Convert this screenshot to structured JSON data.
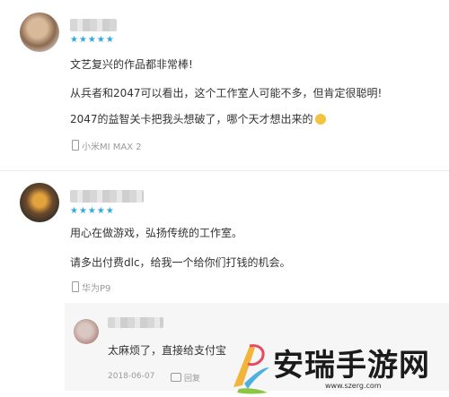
{
  "comments": [
    {
      "stars": "★★★★★",
      "lines": [
        "文艺复兴的作品都非常棒!",
        "从兵者和2047可以看出，这个工作室人可能不多，但肯定很聪明!",
        "2047的益智关卡把我头想破了，哪个天才想出来的"
      ],
      "device": "小米MI MAX 2"
    },
    {
      "stars": "★★★★★",
      "lines": [
        "用心在做游戏，弘扬传统的工作室。",
        "请多出付费dlc，给我一个给你们打钱的机会。"
      ],
      "device": "华为P9"
    }
  ],
  "reply": {
    "text": "太麻烦了，直接给支付宝",
    "date": "2018-06-07",
    "reply_label": "回复"
  },
  "watermark": {
    "brand": "安瑞手游网",
    "url": "www.szerg.com"
  },
  "colors": {
    "stars": "#2eaadf"
  }
}
